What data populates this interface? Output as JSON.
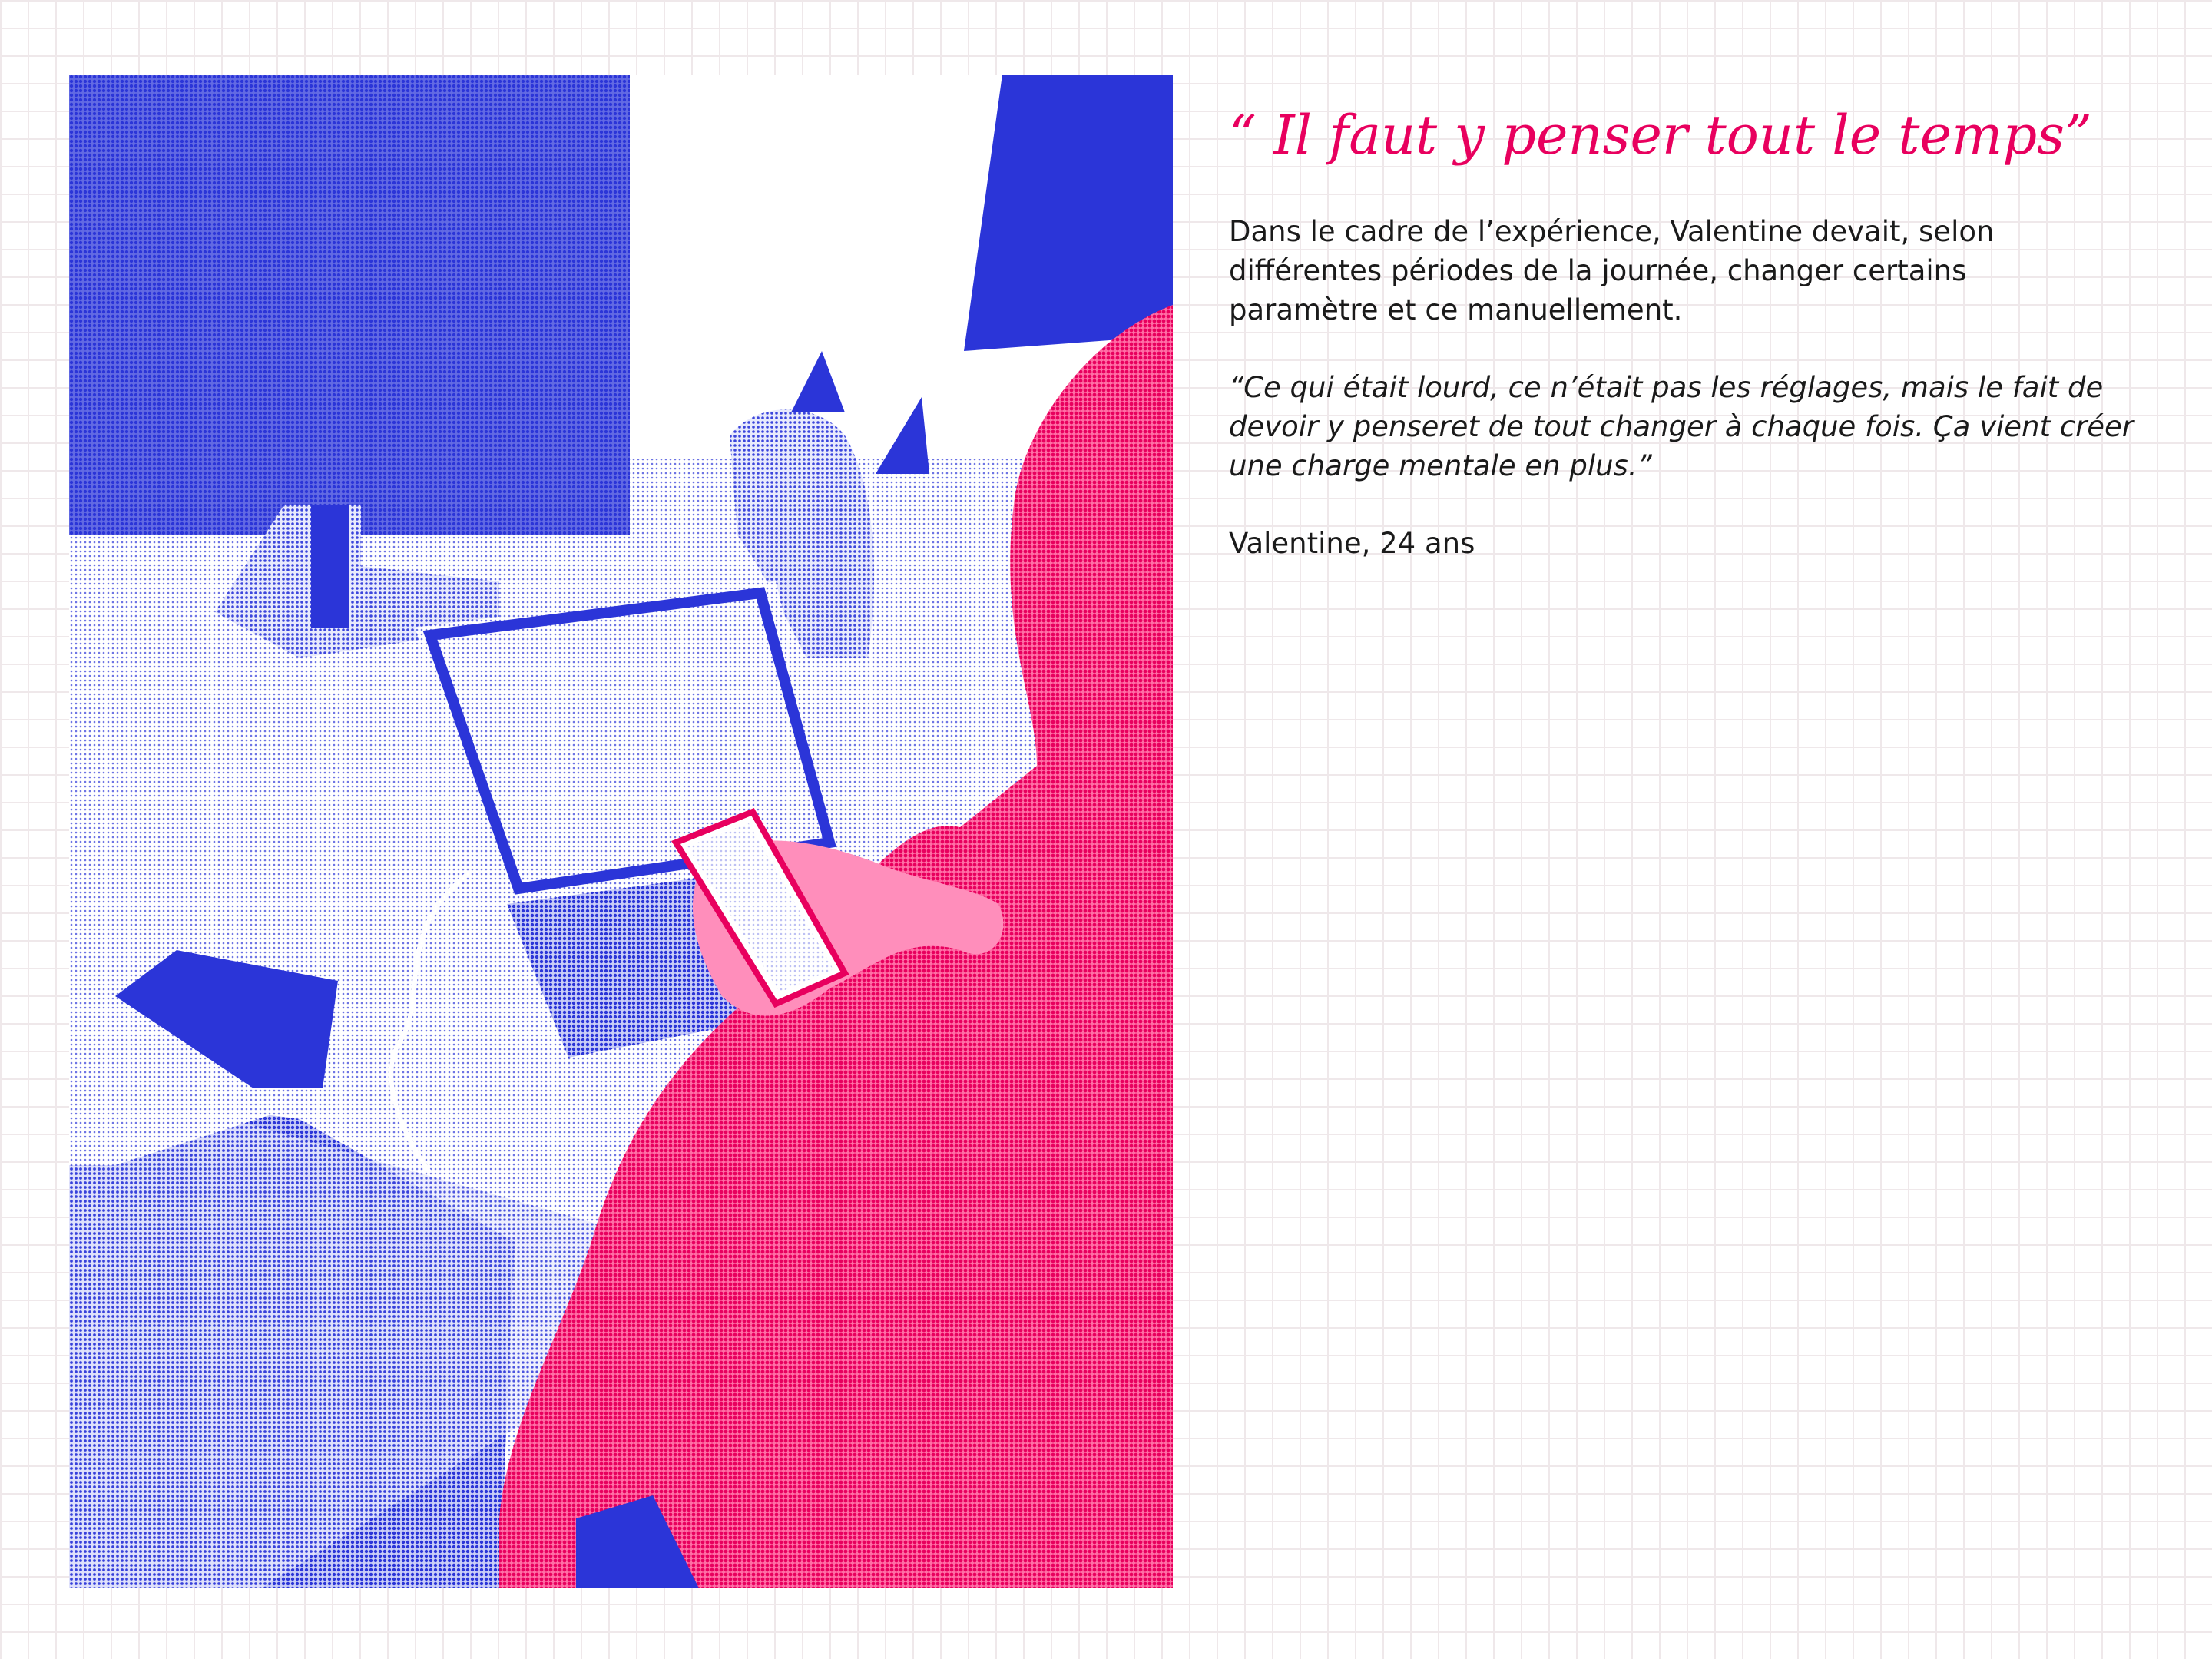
{
  "headline": "“ Il faut y penser tout le temps”",
  "body": {
    "line_1": "Dans le cadre de l’expérience, Valentine devait, selon",
    "line_2": "différentes périodes de la journée, changer certains",
    "line_3": "paramètre et ce manuellement."
  },
  "quote": {
    "line_1": "“Ce qui était lourd, ce n’était pas les réglages, mais le fait de",
    "line_2": "devoir y penseret de tout changer à chaque fois. Ça vient créer",
    "line_3": "une charge mentale en plus.”"
  },
  "author": "Valentine, 24 ans",
  "colors": {
    "accent_pink": "#e8005e",
    "photo_blue": "#2b35d8",
    "grid_line": "#efe8ea",
    "text": "#1a1a1a"
  }
}
